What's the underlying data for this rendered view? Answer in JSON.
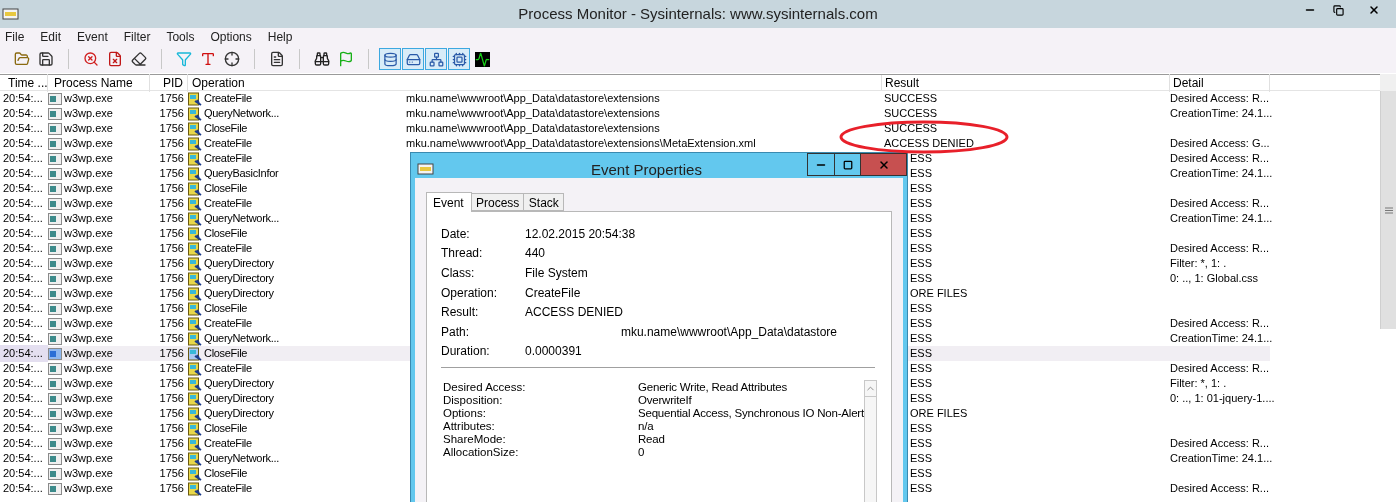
{
  "window": {
    "title": "Process Monitor - Sysinternals: www.sysinternals.com"
  },
  "menu": [
    "File",
    "Edit",
    "Event",
    "Filter",
    "Tools",
    "Options",
    "Help"
  ],
  "event_class_filters": [
    {
      "on": true
    },
    {
      "on": true
    },
    {
      "on": true
    },
    {
      "on": true
    },
    {
      "on": false
    }
  ],
  "table": {
    "columns": [
      "Time ...",
      "Process Name",
      "PID",
      "Operation",
      "Result",
      "Detail"
    ],
    "rows": [
      {
        "time": "20:54:...",
        "process": "w3wp.exe",
        "pid": "1756",
        "operation": "CreateFile",
        "path": "mku.name\\wwwroot\\App_Data\\datastore\\extensions",
        "result": "SUCCESS",
        "detail": "Desired Access: R...",
        "selected": false
      },
      {
        "time": "20:54:...",
        "process": "w3wp.exe",
        "pid": "1756",
        "operation": "QueryNetwork...",
        "path": "mku.name\\wwwroot\\App_Data\\datastore\\extensions",
        "result": "SUCCESS",
        "detail": "CreationTime: 24.1...",
        "selected": false
      },
      {
        "time": "20:54:...",
        "process": "w3wp.exe",
        "pid": "1756",
        "operation": "CloseFile",
        "path": "mku.name\\wwwroot\\App_Data\\datastore\\extensions",
        "result": "SUCCESS",
        "selected": false
      },
      {
        "time": "20:54:...",
        "process": "w3wp.exe",
        "pid": "1756",
        "operation": "CreateFile",
        "path": "mku.name\\wwwroot\\App_Data\\datastore\\extensions\\MetaExtension.xml",
        "result": "ACCESS DENIED",
        "detail": "Desired Access: G...",
        "selected": false
      },
      {
        "time": "20:54:...",
        "process": "w3wp.exe",
        "pid": "1756",
        "operation": "CreateFile",
        "result": "ESS",
        "detail": "Desired Access: R...",
        "selected": false
      },
      {
        "time": "20:54:...",
        "process": "w3wp.exe",
        "pid": "1756",
        "operation": "QueryBasicInfor",
        "result": "ESS",
        "detail": "CreationTime: 24.1...",
        "selected": false
      },
      {
        "time": "20:54:...",
        "process": "w3wp.exe",
        "pid": "1756",
        "operation": "CloseFile",
        "result": "ESS",
        "selected": false
      },
      {
        "time": "20:54:...",
        "process": "w3wp.exe",
        "pid": "1756",
        "operation": "CreateFile",
        "result": "ESS",
        "detail": "Desired Access: R...",
        "selected": false
      },
      {
        "time": "20:54:...",
        "process": "w3wp.exe",
        "pid": "1756",
        "operation": "QueryNetwork...",
        "result": "ESS",
        "detail": "CreationTime: 24.1...",
        "selected": false
      },
      {
        "time": "20:54:...",
        "process": "w3wp.exe",
        "pid": "1756",
        "operation": "CloseFile",
        "result": "ESS",
        "selected": false
      },
      {
        "time": "20:54:...",
        "process": "w3wp.exe",
        "pid": "1756",
        "operation": "CreateFile",
        "result": "ESS",
        "detail": "Desired Access: R...",
        "selected": false
      },
      {
        "time": "20:54:...",
        "process": "w3wp.exe",
        "pid": "1756",
        "operation": "QueryDirectory",
        "result": "ESS",
        "detail": "Filter: *, 1: .",
        "selected": false
      },
      {
        "time": "20:54:...",
        "process": "w3wp.exe",
        "pid": "1756",
        "operation": "QueryDirectory",
        "result": "ESS",
        "detail": "0: .., 1: Global.css",
        "selected": false
      },
      {
        "time": "20:54:...",
        "process": "w3wp.exe",
        "pid": "1756",
        "operation": "QueryDirectory",
        "result": "ORE FILES",
        "selected": false
      },
      {
        "time": "20:54:...",
        "process": "w3wp.exe",
        "pid": "1756",
        "operation": "CloseFile",
        "result": "ESS",
        "selected": false
      },
      {
        "time": "20:54:...",
        "process": "w3wp.exe",
        "pid": "1756",
        "operation": "CreateFile",
        "result": "ESS",
        "detail": "Desired Access: R...",
        "selected": false
      },
      {
        "time": "20:54:...",
        "process": "w3wp.exe",
        "pid": "1756",
        "operation": "QueryNetwork...",
        "result": "ESS",
        "detail": "CreationTime: 24.1...",
        "selected": false
      },
      {
        "time": "20:54:...",
        "process": "w3wp.exe",
        "pid": "1756",
        "operation": "CloseFile",
        "result": "ESS",
        "selected": true
      },
      {
        "time": "20:54:...",
        "process": "w3wp.exe",
        "pid": "1756",
        "operation": "CreateFile",
        "result": "ESS",
        "detail": "Desired Access: R...",
        "selected": false
      },
      {
        "time": "20:54:...",
        "process": "w3wp.exe",
        "pid": "1756",
        "operation": "QueryDirectory",
        "result": "ESS",
        "detail": "Filter: *, 1: .",
        "selected": false
      },
      {
        "time": "20:54:...",
        "process": "w3wp.exe",
        "pid": "1756",
        "operation": "QueryDirectory",
        "result": "ESS",
        "detail": "0: .., 1: 01-jquery-1....",
        "selected": false
      },
      {
        "time": "20:54:...",
        "process": "w3wp.exe",
        "pid": "1756",
        "operation": "QueryDirectory",
        "result": "ORE FILES",
        "selected": false
      },
      {
        "time": "20:54:...",
        "process": "w3wp.exe",
        "pid": "1756",
        "operation": "CloseFile",
        "result": "ESS",
        "selected": false
      },
      {
        "time": "20:54:...",
        "process": "w3wp.exe",
        "pid": "1756",
        "operation": "CreateFile",
        "result": "ESS",
        "detail": "Desired Access: R...",
        "selected": false
      },
      {
        "time": "20:54:...",
        "process": "w3wp.exe",
        "pid": "1756",
        "operation": "QueryNetwork...",
        "result": "ESS",
        "detail": "CreationTime: 24.1...",
        "selected": false
      },
      {
        "time": "20:54:...",
        "process": "w3wp.exe",
        "pid": "1756",
        "operation": "CloseFile",
        "result": "ESS",
        "selected": false
      },
      {
        "time": "20:54:...",
        "process": "w3wp.exe",
        "pid": "1756",
        "operation": "CreateFile",
        "result": "ESS",
        "detail": "Desired Access: R...",
        "selected": false
      }
    ]
  },
  "dialog": {
    "title": "Event Properties",
    "tabs": [
      {
        "label": "Event",
        "selected": true
      },
      {
        "label": "Process",
        "selected": false
      },
      {
        "label": "Stack",
        "selected": false
      }
    ],
    "fields": [
      {
        "label": "Date:",
        "value": "12.02.2015 20:54:38",
        "kind": "text"
      },
      {
        "label": "Thread:",
        "value": "440",
        "kind": "text"
      },
      {
        "label": "Class:",
        "value": "File System",
        "kind": "text"
      },
      {
        "label": "Operation:",
        "value": "CreateFile",
        "kind": "text"
      },
      {
        "label": "Result:",
        "value": "ACCESS DENIED",
        "kind": "text"
      },
      {
        "label": "Path:",
        "value": "mku.name\\wwwroot\\App_Data\\datastore",
        "kind": "path"
      },
      {
        "label": "Duration:",
        "value": "0.0000391",
        "kind": "text"
      }
    ],
    "details": [
      {
        "label": "Desired Access:",
        "value": "Generic Write, Read Attributes"
      },
      {
        "label": "Disposition:",
        "value": "OverwriteIf"
      },
      {
        "label": "Options:",
        "value": "Sequential Access, Synchronous IO Non-Alert"
      },
      {
        "label": "Attributes:",
        "value": "n/a"
      },
      {
        "label": "ShareMode:",
        "value": "Read"
      },
      {
        "label": "AllocationSize:",
        "value": "0"
      }
    ]
  }
}
